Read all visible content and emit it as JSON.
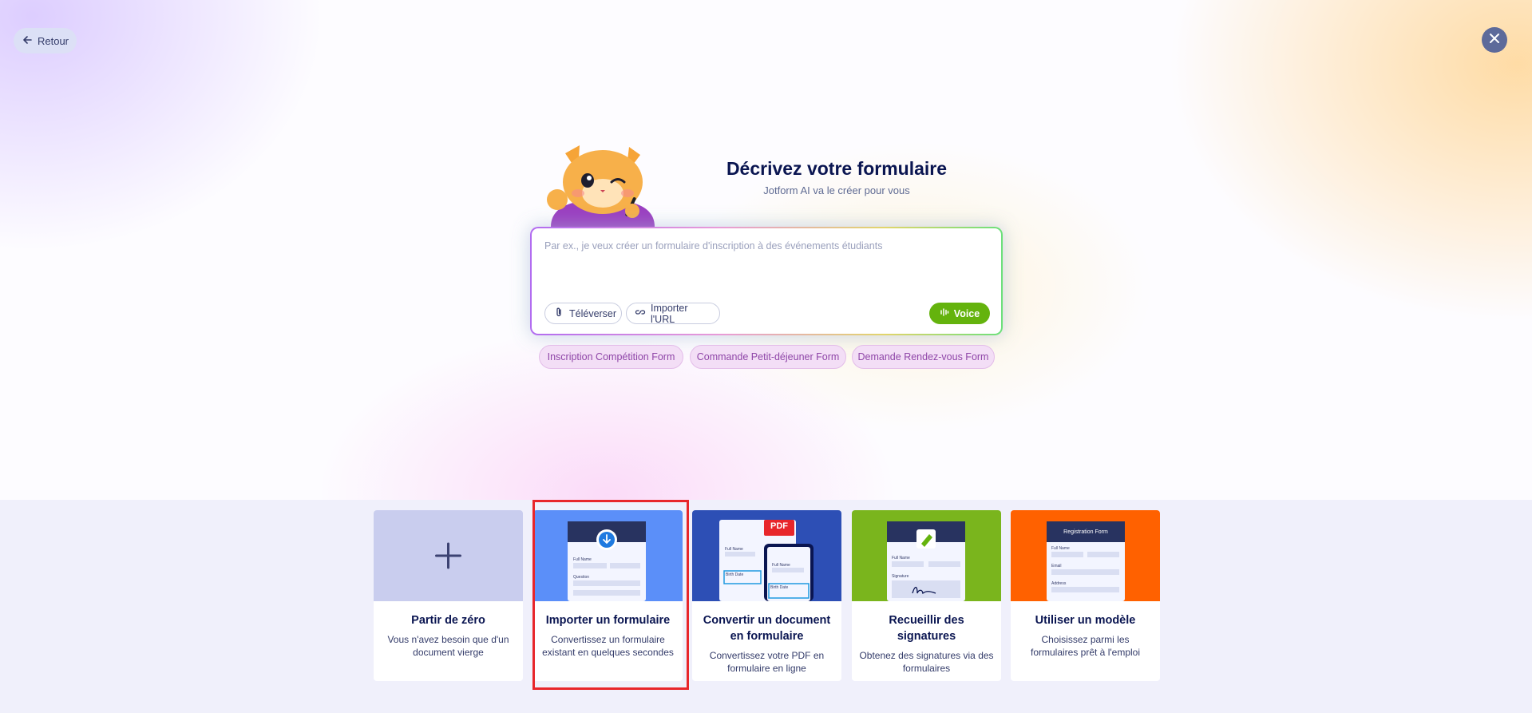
{
  "nav": {
    "back_label": "Retour",
    "back_icon": "arrow-left-icon",
    "close_icon": "close-icon"
  },
  "header": {
    "title": "Décrivez votre formulaire",
    "subtitle": "Jotform AI va le créer pour vous"
  },
  "prompt": {
    "placeholder": "Par ex., je veux créer un formulaire d'inscription à des événements étudiants",
    "upload_label": "Téléverser",
    "import_url_label": "Importer l'URL",
    "voice_label": "Voice"
  },
  "suggestions": [
    "Inscription Compétition Form",
    "Commande Petit-déjeuner Form",
    "Demande Rendez-vous Form"
  ],
  "cards": [
    {
      "title": "Partir de zéro",
      "desc": "Vous n'avez besoin que d'un document vierge",
      "color": "#c9cdee"
    },
    {
      "title": "Importer un formulaire",
      "desc": "Convertissez un formulaire existant en quelques secondes",
      "color": "#5b8ff9"
    },
    {
      "title": "Convertir un document en formulaire",
      "desc": "Convertissez votre PDF en formulaire en ligne",
      "color": "#2d4fb5",
      "badge": "PDF"
    },
    {
      "title": "Recueillir des signatures",
      "desc": "Obtenez des signatures via des formulaires",
      "color": "#7ab51d"
    },
    {
      "title": "Utiliser un modèle",
      "desc": "Choisissez parmi les formulaires prêt à l'emploi",
      "color": "#ff6100",
      "preview_title": "Registration Form"
    }
  ],
  "mock": {
    "full_name": "Full Name",
    "question": "Question",
    "birth_date": "Birth Date",
    "signature": "Signature",
    "email": "Email",
    "address": "Address"
  },
  "colors": {
    "accent_green": "#64b30d",
    "navy": "#0a1551",
    "highlight_red": "#e8262b"
  }
}
